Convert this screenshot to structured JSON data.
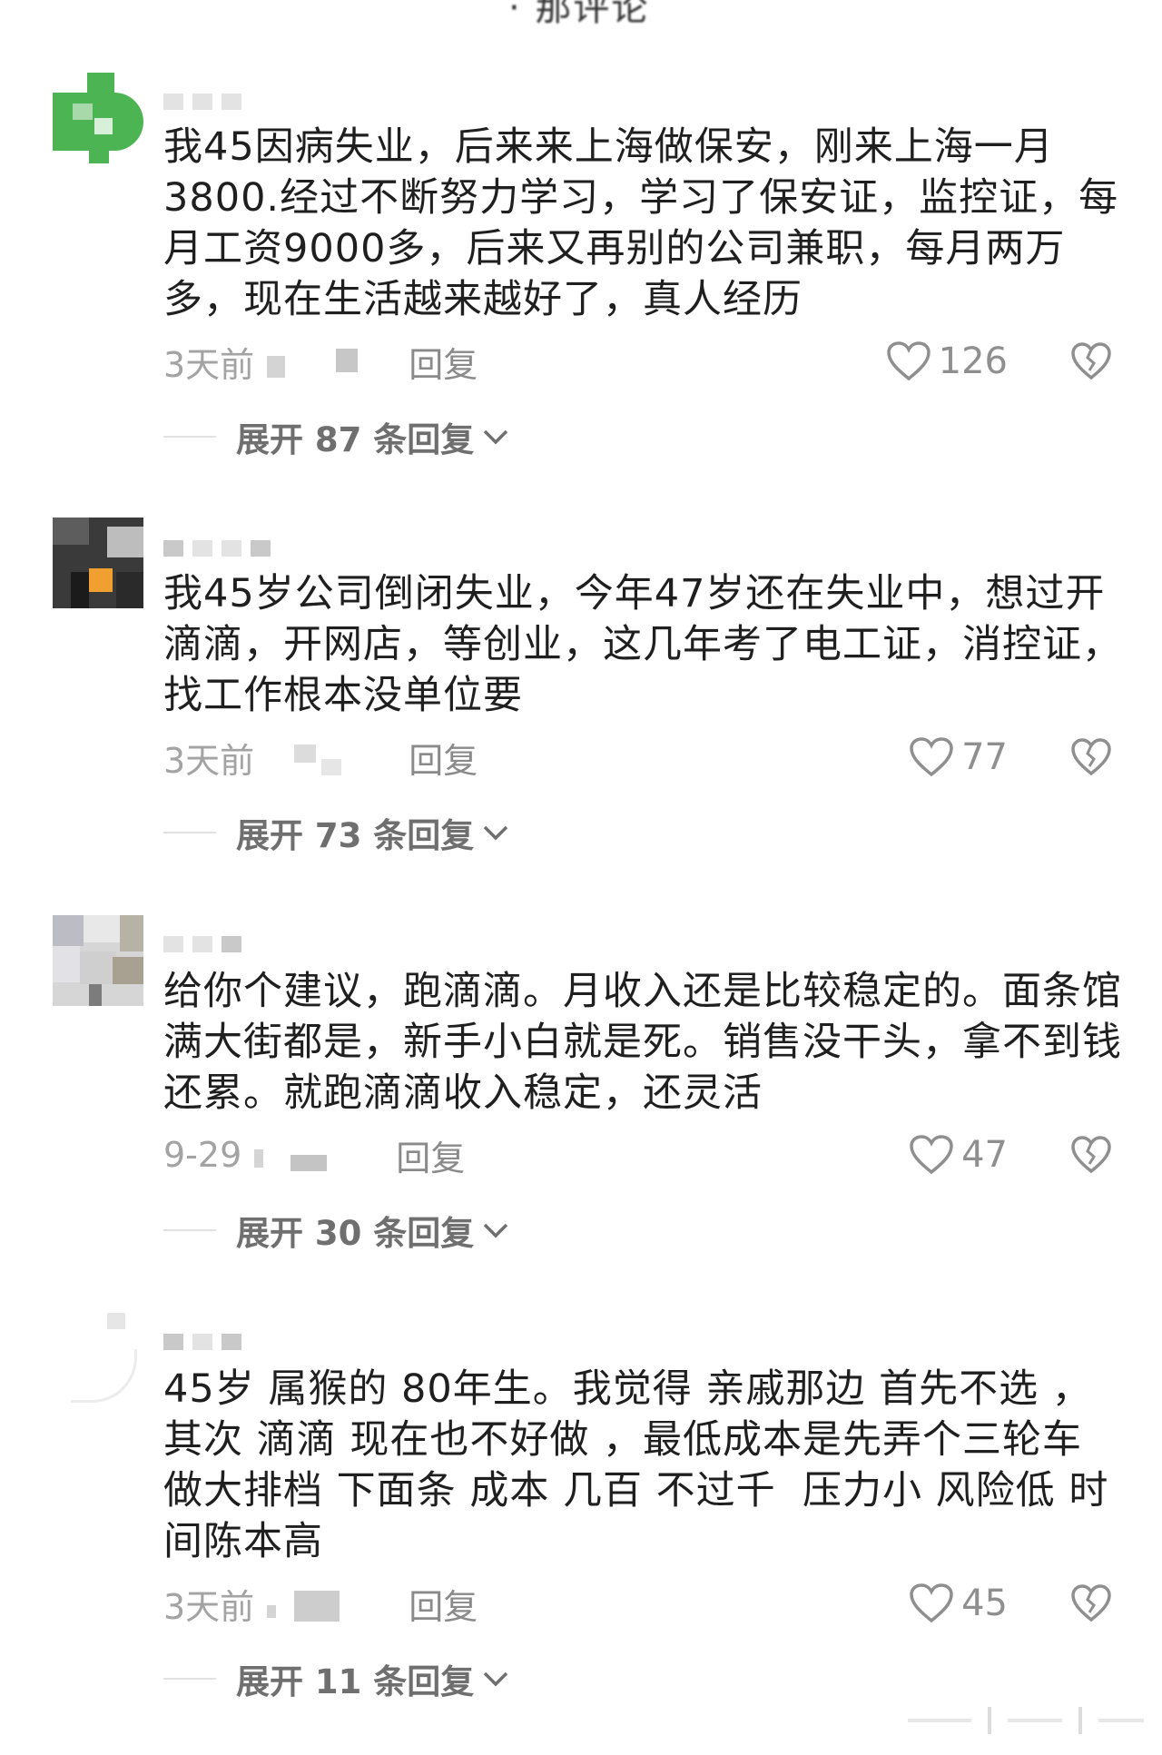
{
  "header": {
    "fragment": "· 那评论"
  },
  "comments": [
    {
      "text": "我45因病失业，后来来上海做保安，刚来上海一月3800.经过不断努力学习，学习了保安证，监控证，每月工资9000多，后来又再别的公司兼职，每月两万多，现在生活越来越好了，真人经历",
      "time": "3天前",
      "reply_label": "回复",
      "likes": "126",
      "expand_label": "展开 87 条回复"
    },
    {
      "text": "我45岁公司倒闭失业，今年47岁还在失业中，想过开滴滴，开网店，等创业，这几年考了电工证，消控证，找工作根本没单位要",
      "time": "3天前",
      "reply_label": "回复",
      "likes": "77",
      "expand_label": "展开 73 条回复"
    },
    {
      "text": "给你个建议，跑滴滴。月收入还是比较稳定的。面条馆满大街都是，新手小白就是死。销售没干头，拿不到钱还累。就跑滴滴收入稳定，还灵活",
      "time": "9-29",
      "reply_label": "回复",
      "likes": "47",
      "expand_label": "展开 30 条回复"
    },
    {
      "text": "45岁 属猴的 80年生。我觉得 亲戚那边 首先不选 ，其次 滴滴 现在也不好做 ，最低成本是先弄个三轮车 做大排档 下面条 成本 几百 不过千  压力小 风险低 时间陈本高",
      "time": "3天前",
      "reply_label": "回复",
      "likes": "45",
      "expand_label": "展开 11 条回复"
    }
  ],
  "colors": {
    "text": "#1f1f1f",
    "meta": "#a3a3a3",
    "expand": "#6f6f6f",
    "avatar1": "#4cb452"
  },
  "icons": {
    "like": "heart-outline-icon",
    "dislike": "broken-heart-icon",
    "expand": "chevron-down-icon"
  }
}
